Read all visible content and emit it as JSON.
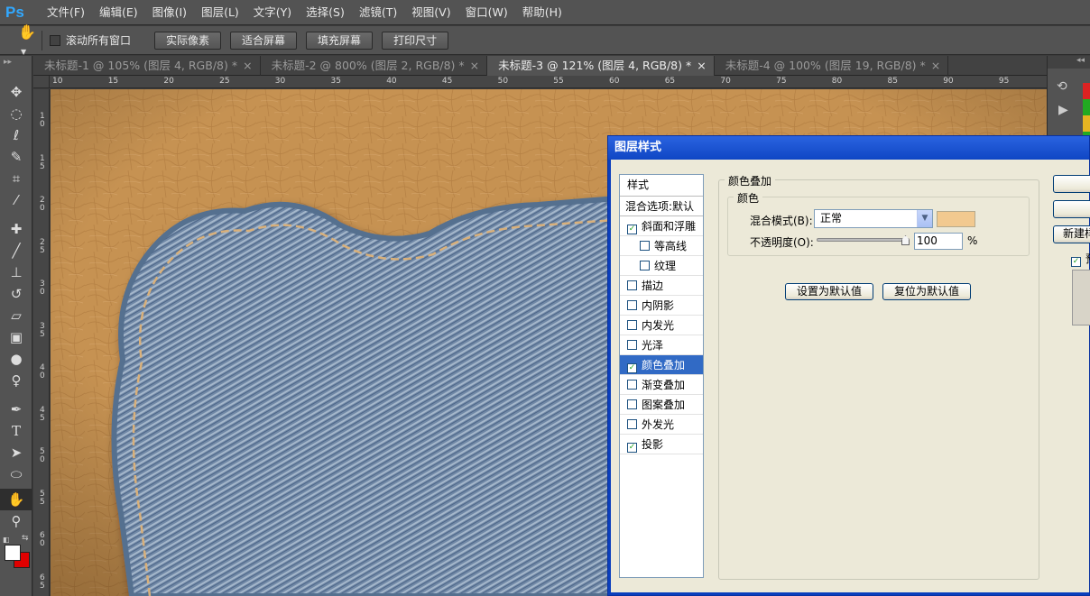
{
  "app": {
    "logo": "Ps"
  },
  "menu": [
    "文件(F)",
    "编辑(E)",
    "图像(I)",
    "图层(L)",
    "文字(Y)",
    "选择(S)",
    "滤镜(T)",
    "视图(V)",
    "窗口(W)",
    "帮助(H)"
  ],
  "options": {
    "scroll_all_label": "滚动所有窗口",
    "buttons": [
      "实际像素",
      "适合屏幕",
      "填充屏幕",
      "打印尺寸"
    ]
  },
  "tabs": [
    {
      "label": "未标题-1 @ 105% (图层 4, RGB/8) *",
      "close": "×"
    },
    {
      "label": "未标题-2 @ 800% (图层 2, RGB/8) *",
      "close": "×"
    },
    {
      "label": "未标题-3 @ 121% (图层 4, RGB/8) *",
      "close": "×"
    },
    {
      "label": "未标题-4 @ 100% (图层 19, RGB/8) *",
      "close": "×"
    }
  ],
  "ruler": {
    "h": [
      "10",
      "15",
      "20",
      "25",
      "30",
      "35",
      "40",
      "45",
      "50",
      "55",
      "60",
      "65",
      "70",
      "75",
      "80",
      "85",
      "90",
      "95"
    ],
    "v": [
      "1\n0",
      "1\n5",
      "2\n0",
      "2\n5",
      "3\n0",
      "3\n5",
      "4\n0",
      "4\n5",
      "5\n0",
      "5\n5",
      "6\n0",
      "6\n5"
    ]
  },
  "dialog": {
    "title": "图层样式",
    "styles_header": "样式",
    "blend_options": "混合选项:默认",
    "items": [
      {
        "label": "斜面和浮雕",
        "checked": "✓",
        "indent": false,
        "selected": false
      },
      {
        "label": "等高线",
        "checked": "",
        "indent": true,
        "selected": false
      },
      {
        "label": "纹理",
        "checked": "",
        "indent": true,
        "selected": false
      },
      {
        "label": "描边",
        "checked": "",
        "indent": false,
        "selected": false
      },
      {
        "label": "内阴影",
        "checked": "",
        "indent": false,
        "selected": false
      },
      {
        "label": "内发光",
        "checked": "",
        "indent": false,
        "selected": false
      },
      {
        "label": "光泽",
        "checked": "",
        "indent": false,
        "selected": false
      },
      {
        "label": "颜色叠加",
        "checked": "✓",
        "indent": false,
        "selected": true
      },
      {
        "label": "渐变叠加",
        "checked": "",
        "indent": false,
        "selected": false
      },
      {
        "label": "图案叠加",
        "checked": "",
        "indent": false,
        "selected": false
      },
      {
        "label": "外发光",
        "checked": "",
        "indent": false,
        "selected": false
      },
      {
        "label": "投影",
        "checked": "✓",
        "indent": false,
        "selected": false
      }
    ],
    "section_title": "颜色叠加",
    "color_group": "颜色",
    "blend_mode_label": "混合模式(B):",
    "blend_mode_value": "正常",
    "overlay_color": "#f2c98f",
    "opacity_label": "不透明度(O):",
    "opacity_value": "100",
    "opacity_unit": "%",
    "opacity_fraction": 1.0,
    "set_default": "设置为默认值",
    "reset_default": "复位为默认值",
    "new_style": "新建样",
    "preview_check": "✓",
    "preview_label": "预"
  },
  "colors": {
    "fg": "#ffffff",
    "bg": "#e00000"
  }
}
